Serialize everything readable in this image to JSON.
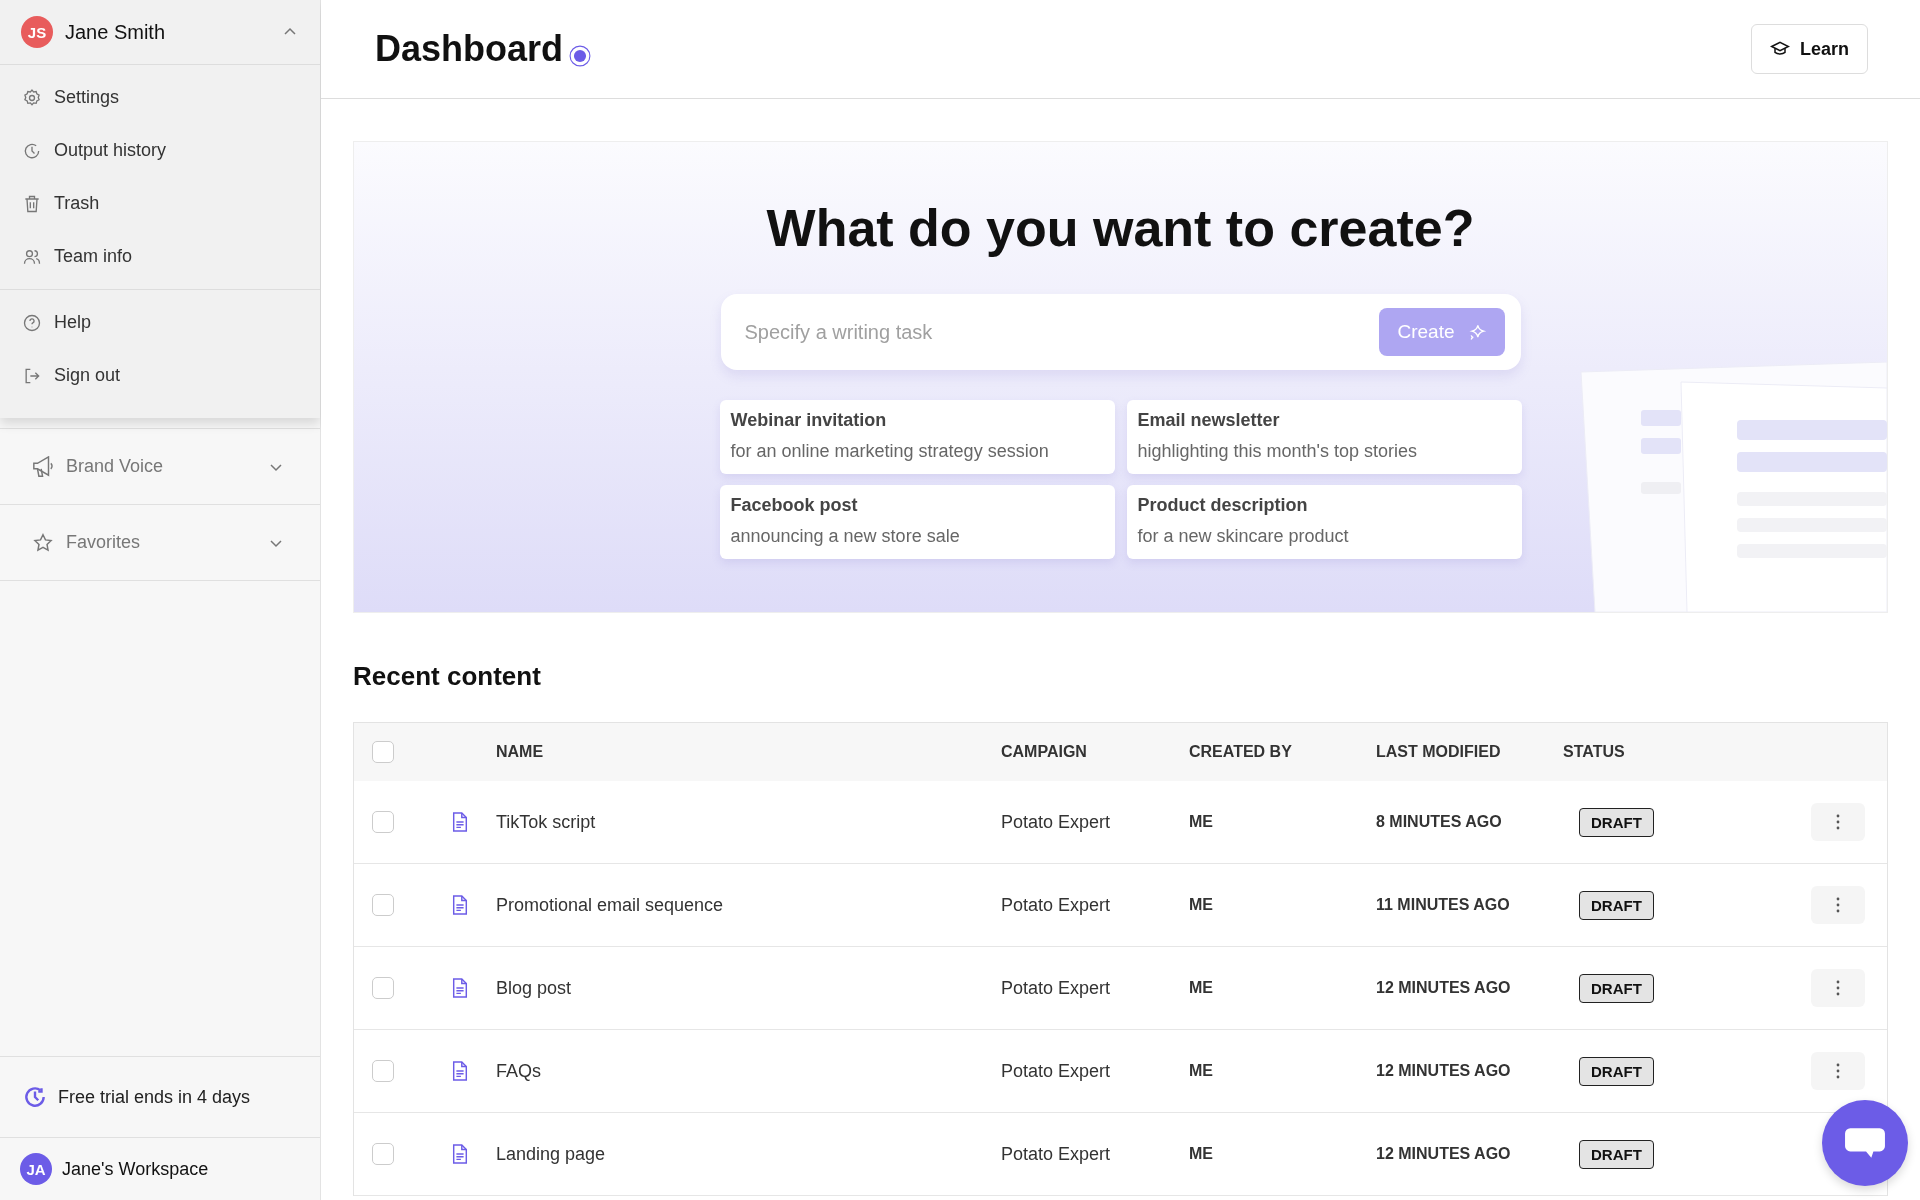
{
  "user_menu": {
    "avatar": "JS",
    "name": "Jane Smith",
    "expanded": true,
    "groups": [
      [
        {
          "label": "Settings"
        },
        {
          "label": "Output history"
        },
        {
          "label": "Trash"
        },
        {
          "label": "Team info"
        }
      ],
      [
        {
          "label": "Help"
        },
        {
          "label": "Sign out"
        }
      ]
    ]
  },
  "sidebar": {
    "sections": [
      {
        "label": "Brand Voice",
        "expanded": false
      },
      {
        "label": "Favorites",
        "expanded": false
      }
    ],
    "trial": "Free trial ends in 4 days",
    "workspace": {
      "avatar": "JA",
      "name": "Jane's Workspace"
    }
  },
  "header": {
    "title": "Dashboard",
    "learn": "Learn"
  },
  "hero": {
    "title": "What do you want to create?",
    "placeholder": "Specify a writing task",
    "create": "Create",
    "suggestions": [
      {
        "title": "Webinar invitation",
        "detail": "for an online marketing strategy session"
      },
      {
        "title": "Email newsletter",
        "detail": "highlighting this month's top stories"
      },
      {
        "title": "Facebook post",
        "detail": "announcing a new store sale"
      },
      {
        "title": "Product description",
        "detail": "for a new skincare product"
      }
    ]
  },
  "recent": {
    "title": "Recent content",
    "all_checked": false,
    "columns": [
      "NAME",
      "CAMPAIGN",
      "CREATED BY",
      "LAST MODIFIED",
      "STATUS"
    ],
    "rows": [
      {
        "checked": false,
        "name": "TikTok script",
        "campaign": "Potato Expert",
        "created_by": "ME",
        "modified": "8 MINUTES AGO",
        "status": "DRAFT"
      },
      {
        "checked": false,
        "name": "Promotional email sequence",
        "campaign": "Potato Expert",
        "created_by": "ME",
        "modified": "11 MINUTES AGO",
        "status": "DRAFT"
      },
      {
        "checked": false,
        "name": "Blog post",
        "campaign": "Potato Expert",
        "created_by": "ME",
        "modified": "12 MINUTES AGO",
        "status": "DRAFT"
      },
      {
        "checked": false,
        "name": "FAQs",
        "campaign": "Potato Expert",
        "created_by": "ME",
        "modified": "12 MINUTES AGO",
        "status": "DRAFT"
      },
      {
        "checked": false,
        "name": "Landing page",
        "campaign": "Potato Expert",
        "created_by": "ME",
        "modified": "12 MINUTES AGO",
        "status": "DRAFT"
      }
    ]
  }
}
